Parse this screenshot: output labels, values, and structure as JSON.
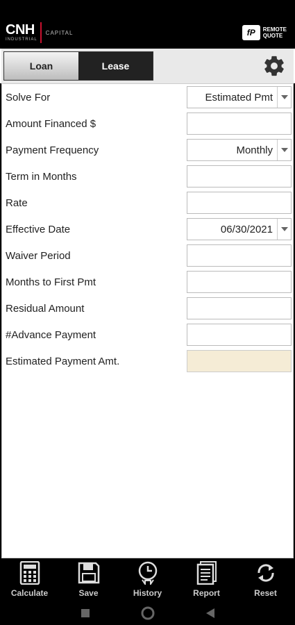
{
  "brand": {
    "main": "CNH",
    "sub": "INDUSTRIAL",
    "capital": "CAPITAL",
    "remote_line1": "REMOTE",
    "remote_line2": "QUOTE"
  },
  "tabs": [
    {
      "label": "Loan",
      "active": false
    },
    {
      "label": "Lease",
      "active": true
    }
  ],
  "form": {
    "solve_for": {
      "label": "Solve For",
      "value": "Estimated Pmt"
    },
    "amount_financed": {
      "label": "Amount Financed $",
      "value": ""
    },
    "payment_frequency": {
      "label": "Payment Frequency",
      "value": "Monthly"
    },
    "term_in_months": {
      "label": "Term in Months",
      "value": ""
    },
    "rate": {
      "label": "Rate",
      "value": ""
    },
    "effective_date": {
      "label": "Effective Date",
      "value": "06/30/2021"
    },
    "waiver_period": {
      "label": "Waiver Period",
      "value": ""
    },
    "months_to_first_pmt": {
      "label": "Months to First Pmt",
      "value": ""
    },
    "residual_amount": {
      "label": "Residual Amount",
      "value": ""
    },
    "advance_payment": {
      "label": "#Advance Payment",
      "value": ""
    },
    "estimated_payment_amt": {
      "label": "Estimated Payment Amt.",
      "value": ""
    }
  },
  "bottom_nav": [
    {
      "label": "Calculate",
      "icon": "calculator-icon"
    },
    {
      "label": "Save",
      "icon": "save-icon"
    },
    {
      "label": "History",
      "icon": "history-icon"
    },
    {
      "label": "Report",
      "icon": "report-icon"
    },
    {
      "label": "Reset",
      "icon": "reset-icon"
    }
  ],
  "colors": {
    "accent_red": "#c8102e",
    "result_field": "#f5ecd6",
    "tab_active": "#222222"
  }
}
